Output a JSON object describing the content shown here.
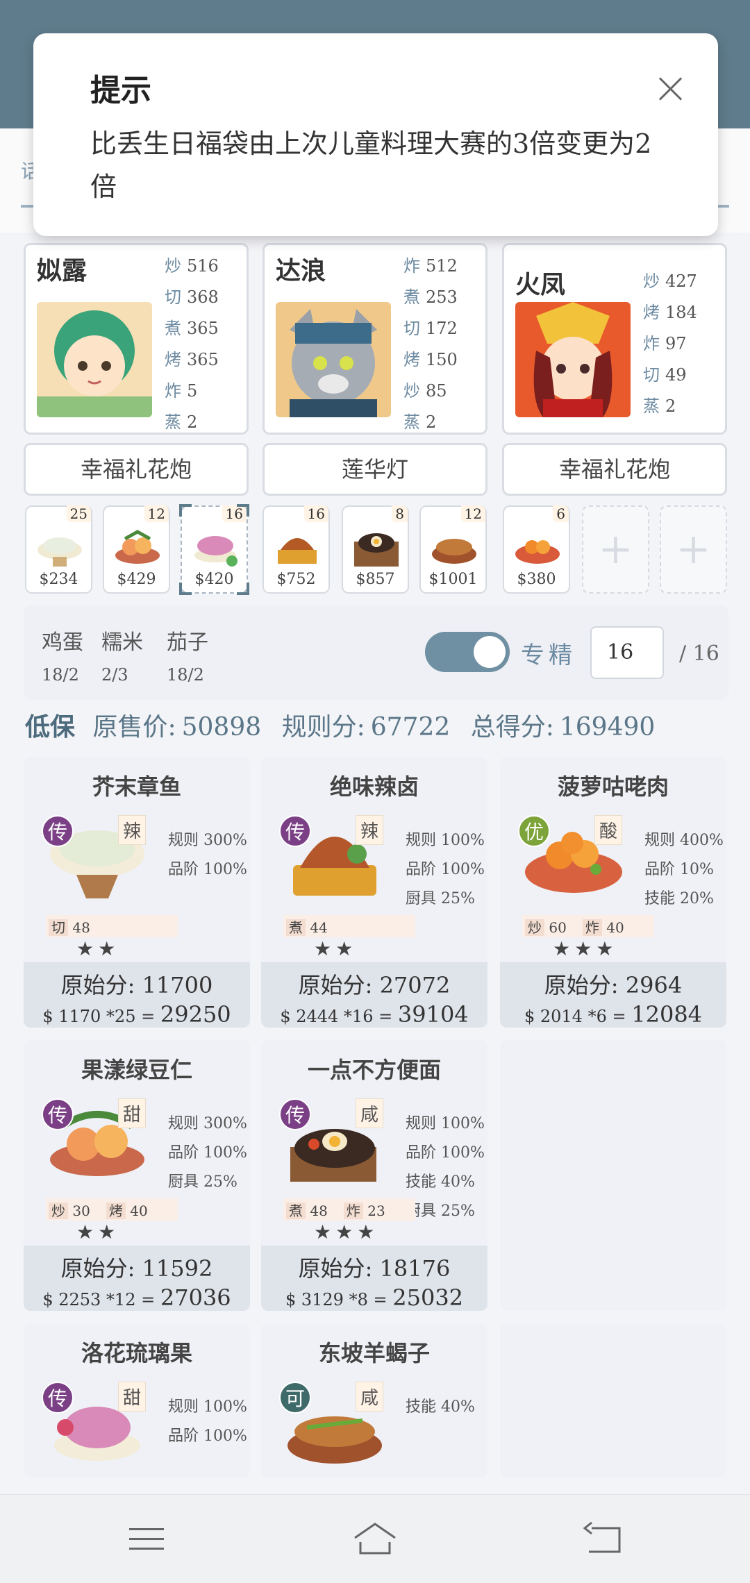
{
  "modal": {
    "title": "提示",
    "message": "比丢生日福袋由上次儿童料理大赛的3倍变更为2倍"
  },
  "tab_fragment": "话",
  "chefs": [
    {
      "name": "姒露",
      "skills": [
        [
          "炒",
          "516"
        ],
        [
          "切",
          "368"
        ],
        [
          "煮",
          "365"
        ],
        [
          "烤",
          "365"
        ],
        [
          "炸",
          "5"
        ],
        [
          "蒸",
          "2"
        ]
      ],
      "equip": "幸福礼花炮"
    },
    {
      "name": "达浪",
      "skills": [
        [
          "炸",
          "512"
        ],
        [
          "煮",
          "253"
        ],
        [
          "切",
          "172"
        ],
        [
          "烤",
          "150"
        ],
        [
          "炒",
          "85"
        ],
        [
          "蒸",
          "2"
        ]
      ],
      "equip": "莲华灯"
    },
    {
      "name": "火凤",
      "skills": [
        [
          "炒",
          "427"
        ],
        [
          "烤",
          "184"
        ],
        [
          "炸",
          "97"
        ],
        [
          "切",
          "49"
        ],
        [
          "蒸",
          "2"
        ]
      ],
      "equip": "幸福礼花炮"
    }
  ],
  "tiles": [
    {
      "count": "25",
      "price": "$234"
    },
    {
      "count": "12",
      "price": "$429"
    },
    {
      "count": "16",
      "price": "$420"
    },
    {
      "count": "16",
      "price": "$752"
    },
    {
      "count": "8",
      "price": "$857"
    },
    {
      "count": "12",
      "price": "$1001"
    },
    {
      "count": "6",
      "price": "$380"
    }
  ],
  "plus_symbol": "+",
  "settings": {
    "ingredients": [
      {
        "name": "鸡蛋",
        "value": "18/2"
      },
      {
        "name": "糯米",
        "value": "2/3"
      },
      {
        "name": "茄子",
        "value": "18/2"
      }
    ],
    "toggle_label": "专精",
    "input_value": "16",
    "total": "/ 16"
  },
  "summary": {
    "pack": "低保",
    "orig_label": "原售价:",
    "orig_value": "50898",
    "rule_label": "规则分:",
    "rule_value": "67722",
    "total_label": "总得分:",
    "total_value": "169490"
  },
  "dishes": [
    {
      "name": "芥末章鱼",
      "rank": "传",
      "taste": "辣",
      "stats": [
        "规则 300%",
        "品阶 100%"
      ],
      "reqs": [
        [
          "切",
          "48"
        ]
      ],
      "stars": "★★",
      "orig": "原始分: 11700",
      "calc": "$ 1170 *25 =",
      "result": "29250"
    },
    {
      "name": "绝味辣卤",
      "rank": "传",
      "taste": "辣",
      "stats": [
        "规则 100%",
        "品阶 100%",
        "厨具 25%"
      ],
      "reqs": [
        [
          "煮",
          "44"
        ]
      ],
      "stars": "★★",
      "orig": "原始分: 27072",
      "calc": "$ 2444 *16 =",
      "result": "39104"
    },
    {
      "name": "菠萝咕咾肉",
      "rank": "优",
      "taste": "酸",
      "stats": [
        "规则 400%",
        "品阶 10%",
        "技能 20%"
      ],
      "reqs": [
        [
          "炒",
          "60"
        ],
        [
          "炸",
          "40"
        ]
      ],
      "stars": "★★★",
      "orig": "原始分: 2964",
      "calc": "$ 2014 *6 =",
      "result": "12084"
    },
    {
      "name": "果漾绿豆仁",
      "rank": "传",
      "taste": "甜",
      "stats": [
        "规则 300%",
        "品阶 100%",
        "厨具 25%"
      ],
      "reqs": [
        [
          "炒",
          "30"
        ],
        [
          "烤",
          "40"
        ]
      ],
      "stars": "★★",
      "orig": "原始分: 11592",
      "calc": "$ 2253 *12 =",
      "result": "27036"
    },
    {
      "name": "一点不方便面",
      "rank": "传",
      "taste": "咸",
      "stats": [
        "规则 100%",
        "品阶 100%",
        "技能 40%",
        "厨具 25%"
      ],
      "reqs": [
        [
          "煮",
          "48"
        ],
        [
          "炸",
          "23"
        ]
      ],
      "stars": "★★★",
      "orig": "原始分: 18176",
      "calc": "$ 3129 *8 =",
      "result": "25032"
    },
    {
      "name": "洛花琉璃果",
      "rank": "传",
      "taste": "甜",
      "stats": [
        "规则 100%",
        "品阶 100%"
      ]
    },
    {
      "name": "东坡羊蝎子",
      "rank": "可",
      "taste": "咸",
      "stats": [
        "技能 40%"
      ]
    }
  ]
}
